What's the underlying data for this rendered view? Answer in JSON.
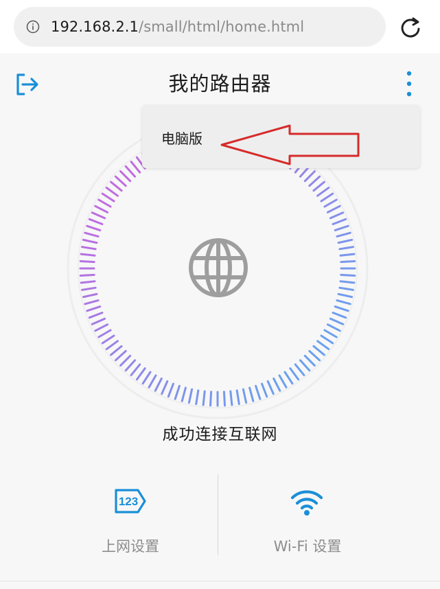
{
  "browser": {
    "url_host": "192.168.2.1",
    "url_path": "/small/html/home.html",
    "icons": {
      "info": "info-icon",
      "reload": "reload-icon"
    }
  },
  "header": {
    "title": "我的路由器",
    "icons": {
      "left": "exit-icon",
      "right": "more-vertical-icon"
    }
  },
  "menu": {
    "items": [
      {
        "label": "电脑版"
      }
    ]
  },
  "status": {
    "text": "成功连接互联网",
    "icon": "globe-icon"
  },
  "actions": [
    {
      "label": "上网设置",
      "icon": "network-123-icon"
    },
    {
      "label": "Wi-Fi 设置",
      "icon": "wifi-icon"
    }
  ],
  "colors": {
    "accent": "#1a8fd8",
    "gauge_start": "#c06be0",
    "gauge_end": "#6aa0ee",
    "annotation_arrow": "#d62b2b",
    "globe": "#9e9e9e"
  }
}
